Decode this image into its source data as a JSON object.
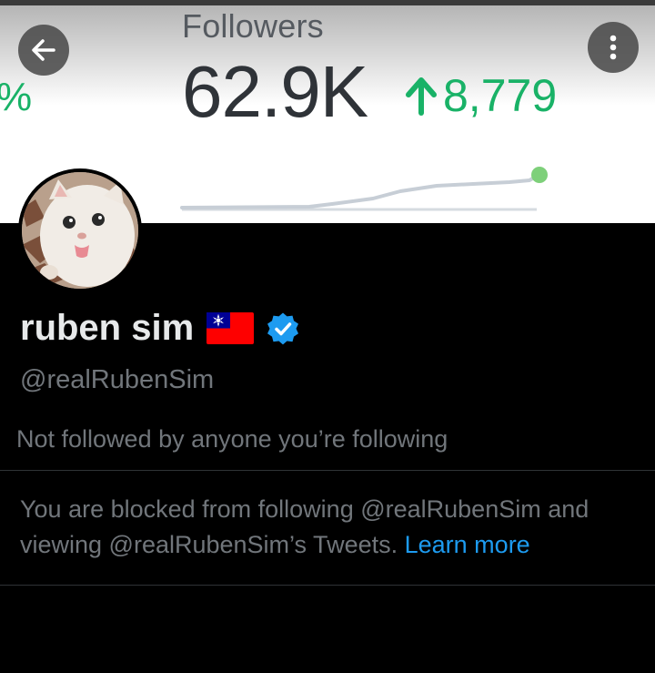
{
  "banner": {
    "stat_label": "Followers",
    "stat_value": "62.9K",
    "stat_delta": "8,779",
    "partial_left_text": "%",
    "delta_color": "#19b267",
    "icons": [
      "arrow-up-icon",
      "sparkline-chart"
    ]
  },
  "header": {
    "back_icon": "arrow-left-icon",
    "more_icon": "vertical-dots-icon"
  },
  "profile": {
    "display_name": "ruben sim",
    "flag_icon": "taiwan-flag-icon",
    "verified_icon": "verified-badge-icon",
    "verified_color": "#1d9bf0",
    "handle": "@realRubenSim",
    "followers_note": "Not followed by anyone you’re following"
  },
  "blocked": {
    "message": "You are blocked from following @realRubenSim and viewing @realRubenSim’s Tweets.",
    "learn_more": "Learn more",
    "link_color": "#1d9bf0"
  }
}
